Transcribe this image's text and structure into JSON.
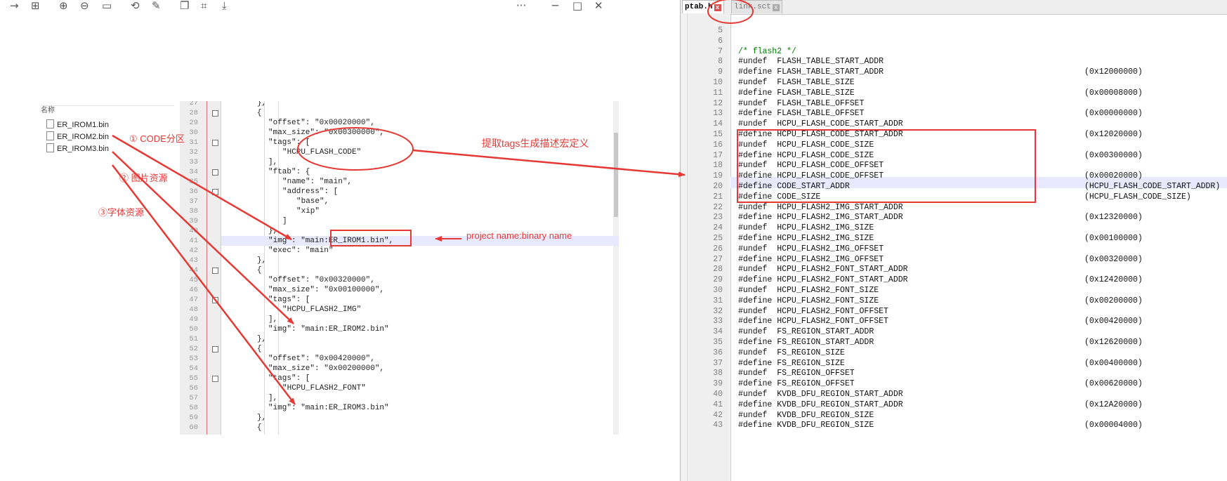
{
  "toolbar": {
    "icons": [
      "forward-icon",
      "grid-icon",
      "zoom-in-icon",
      "zoom-out-icon",
      "fit-icon",
      "rotate-icon",
      "edit-icon",
      "copy-icon",
      "crop-icon",
      "save-icon",
      "more-icon",
      "minimize-icon",
      "maximize-icon",
      "close-icon"
    ],
    "more": "···",
    "min": "─",
    "max": "□",
    "close": "✕"
  },
  "file_list": {
    "header": "名称",
    "files": [
      "ER_IROM1.bin",
      "ER_IROM2.bin",
      "ER_IROM3.bin"
    ]
  },
  "left_editor": {
    "lines": [
      {
        "n": "27",
        "t": "},"
      },
      {
        "n": "28",
        "t": "{"
      },
      {
        "n": "29",
        "t": "\"offset\": \"0x00020000\","
      },
      {
        "n": "30",
        "t": "\"max_size\": \"0x00300000\","
      },
      {
        "n": "31",
        "t": "\"tags\": ["
      },
      {
        "n": "32",
        "t": "\"HCPU_FLASH_CODE\""
      },
      {
        "n": "33",
        "t": "],"
      },
      {
        "n": "34",
        "t": "\"ftab\": {"
      },
      {
        "n": "35",
        "t": "\"name\": \"main\","
      },
      {
        "n": "36",
        "t": "\"address\": ["
      },
      {
        "n": "37",
        "t": "\"base\","
      },
      {
        "n": "38",
        "t": "\"xip\""
      },
      {
        "n": "39",
        "t": "]"
      },
      {
        "n": "40",
        "t": "},"
      },
      {
        "n": "41",
        "t": "\"img\": \"main:ER_IROM1.bin\","
      },
      {
        "n": "42",
        "t": "\"exec\": \"main\""
      },
      {
        "n": "43",
        "t": "},"
      },
      {
        "n": "44",
        "t": "{"
      },
      {
        "n": "45",
        "t": "\"offset\": \"0x00320000\","
      },
      {
        "n": "46",
        "t": "\"max_size\": \"0x00100000\","
      },
      {
        "n": "47",
        "t": "\"tags\": ["
      },
      {
        "n": "48",
        "t": "\"HCPU_FLASH2_IMG\""
      },
      {
        "n": "49",
        "t": "],"
      },
      {
        "n": "50",
        "t": "\"img\": \"main:ER_IROM2.bin\""
      },
      {
        "n": "51",
        "t": "},"
      },
      {
        "n": "52",
        "t": "{"
      },
      {
        "n": "53",
        "t": "\"offset\": \"0x00420000\","
      },
      {
        "n": "54",
        "t": "\"max_size\": \"0x00200000\","
      },
      {
        "n": "55",
        "t": "\"tags\": ["
      },
      {
        "n": "56",
        "t": "\"HCPU_FLASH2_FONT\""
      },
      {
        "n": "57",
        "t": "],"
      },
      {
        "n": "58",
        "t": "\"img\": \"main:ER_IROM3.bin\""
      },
      {
        "n": "59",
        "t": "},"
      },
      {
        "n": "60",
        "t": "{"
      }
    ]
  },
  "right_editor": {
    "tabs": [
      {
        "label": "ptab.h",
        "active": true
      },
      {
        "label": "link.sct",
        "active": false
      }
    ],
    "lines": [
      {
        "n": "5",
        "t": "",
        "v": ""
      },
      {
        "n": "6",
        "t": "",
        "v": ""
      },
      {
        "n": "7",
        "t": "/* flash2 */",
        "v": ""
      },
      {
        "n": "8",
        "t": "#undef  FLASH_TABLE_START_ADDR",
        "v": ""
      },
      {
        "n": "9",
        "t": "#define FLASH_TABLE_START_ADDR",
        "v": "(0x12000000)"
      },
      {
        "n": "10",
        "t": "#undef  FLASH_TABLE_SIZE",
        "v": ""
      },
      {
        "n": "11",
        "t": "#define FLASH_TABLE_SIZE",
        "v": "(0x00008000)"
      },
      {
        "n": "12",
        "t": "#undef  FLASH_TABLE_OFFSET",
        "v": ""
      },
      {
        "n": "13",
        "t": "#define FLASH_TABLE_OFFSET",
        "v": "(0x00000000)"
      },
      {
        "n": "14",
        "t": "#undef  HCPU_FLASH_CODE_START_ADDR",
        "v": ""
      },
      {
        "n": "15",
        "t": "#define HCPU_FLASH_CODE_START_ADDR",
        "v": "(0x12020000)"
      },
      {
        "n": "16",
        "t": "#undef  HCPU_FLASH_CODE_SIZE",
        "v": ""
      },
      {
        "n": "17",
        "t": "#define HCPU_FLASH_CODE_SIZE",
        "v": "(0x00300000)"
      },
      {
        "n": "18",
        "t": "#undef  HCPU_FLASH_CODE_OFFSET",
        "v": ""
      },
      {
        "n": "19",
        "t": "#define HCPU_FLASH_CODE_OFFSET",
        "v": "(0x00020000)"
      },
      {
        "n": "20",
        "t": "#define CODE_START_ADDR",
        "v": "(HCPU_FLASH_CODE_START_ADDR)"
      },
      {
        "n": "21",
        "t": "#define CODE_SIZE",
        "v": "(HCPU_FLASH_CODE_SIZE)"
      },
      {
        "n": "22",
        "t": "#undef  HCPU_FLASH2_IMG_START_ADDR",
        "v": ""
      },
      {
        "n": "23",
        "t": "#define HCPU_FLASH2_IMG_START_ADDR",
        "v": "(0x12320000)"
      },
      {
        "n": "24",
        "t": "#undef  HCPU_FLASH2_IMG_SIZE",
        "v": ""
      },
      {
        "n": "25",
        "t": "#define HCPU_FLASH2_IMG_SIZE",
        "v": "(0x00100000)"
      },
      {
        "n": "26",
        "t": "#undef  HCPU_FLASH2_IMG_OFFSET",
        "v": ""
      },
      {
        "n": "27",
        "t": "#define HCPU_FLASH2_IMG_OFFSET",
        "v": "(0x00320000)"
      },
      {
        "n": "28",
        "t": "#undef  HCPU_FLASH2_FONT_START_ADDR",
        "v": ""
      },
      {
        "n": "29",
        "t": "#define HCPU_FLASH2_FONT_START_ADDR",
        "v": "(0x12420000)"
      },
      {
        "n": "30",
        "t": "#undef  HCPU_FLASH2_FONT_SIZE",
        "v": ""
      },
      {
        "n": "31",
        "t": "#define HCPU_FLASH2_FONT_SIZE",
        "v": "(0x00200000)"
      },
      {
        "n": "32",
        "t": "#undef  HCPU_FLASH2_FONT_OFFSET",
        "v": ""
      },
      {
        "n": "33",
        "t": "#define HCPU_FLASH2_FONT_OFFSET",
        "v": "(0x00420000)"
      },
      {
        "n": "34",
        "t": "#undef  FS_REGION_START_ADDR",
        "v": ""
      },
      {
        "n": "35",
        "t": "#define FS_REGION_START_ADDR",
        "v": "(0x12620000)"
      },
      {
        "n": "36",
        "t": "#undef  FS_REGION_SIZE",
        "v": ""
      },
      {
        "n": "37",
        "t": "#define FS_REGION_SIZE",
        "v": "(0x00400000)"
      },
      {
        "n": "38",
        "t": "#undef  FS_REGION_OFFSET",
        "v": ""
      },
      {
        "n": "39",
        "t": "#define FS_REGION_OFFSET",
        "v": "(0x00620000)"
      },
      {
        "n": "40",
        "t": "#undef  KVDB_DFU_REGION_START_ADDR",
        "v": ""
      },
      {
        "n": "41",
        "t": "#define KVDB_DFU_REGION_START_ADDR",
        "v": "(0x12A20000)"
      },
      {
        "n": "42",
        "t": "#undef  KVDB_DFU_REGION_SIZE",
        "v": ""
      },
      {
        "n": "43",
        "t": "#define KVDB_DFU_REGION_SIZE",
        "v": "(0x00004000)"
      }
    ]
  },
  "annotations": {
    "code_partition": "① CODE分区",
    "image_resource": "② 图片资源",
    "font_resource": "③字体资源",
    "extract_tags": "提取tags生成描述宏定义",
    "project_binary": "project name:binary name"
  },
  "colors": {
    "annotation_red": "#e53935",
    "keyword_purple": "#8b1a8b",
    "string_darkred": "#8b0000",
    "comment_green": "#008000",
    "line_highlight": "#e8e8ff"
  }
}
